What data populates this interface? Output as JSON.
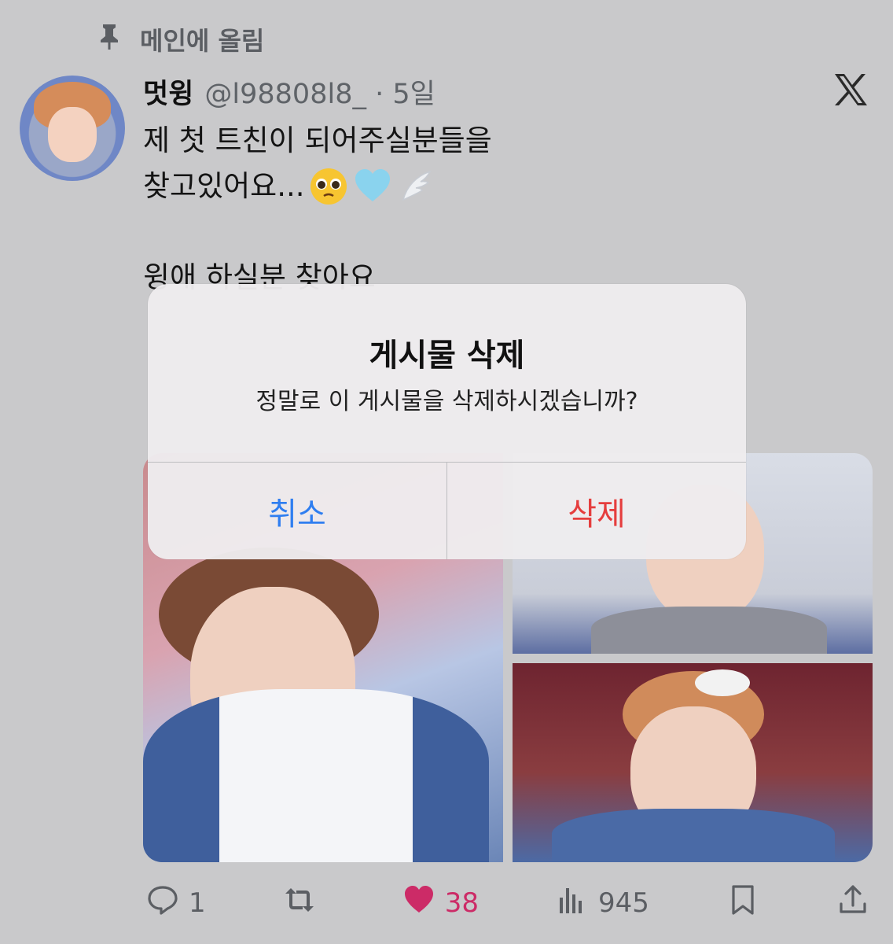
{
  "pinned": {
    "label": "메인에 올림",
    "icon": "pin-icon"
  },
  "tweet": {
    "display_name": "멋윙",
    "handle_time": "@l98808l8_ · 5일",
    "lines": [
      "제 첫 트친이 되어주실분들을",
      "찾고있어요...",
      "",
      "윙애 하실분 찾아요"
    ],
    "emojis": [
      "pleading-face-emoji",
      "light-blue-heart-emoji",
      "wing-emoji"
    ]
  },
  "actions": {
    "replies": "1",
    "reposts": "",
    "likes": "38",
    "views": "945"
  },
  "alert": {
    "title": "게시물 삭제",
    "message": "정말로 이 게시물을 삭제하시겠습니까?",
    "cancel_label": "취소",
    "delete_label": "삭제"
  },
  "colors": {
    "like": "#cc2b67",
    "cancel": "#2f7ef0",
    "delete": "#e53d3d",
    "secondary_text": "#5b5e63"
  }
}
